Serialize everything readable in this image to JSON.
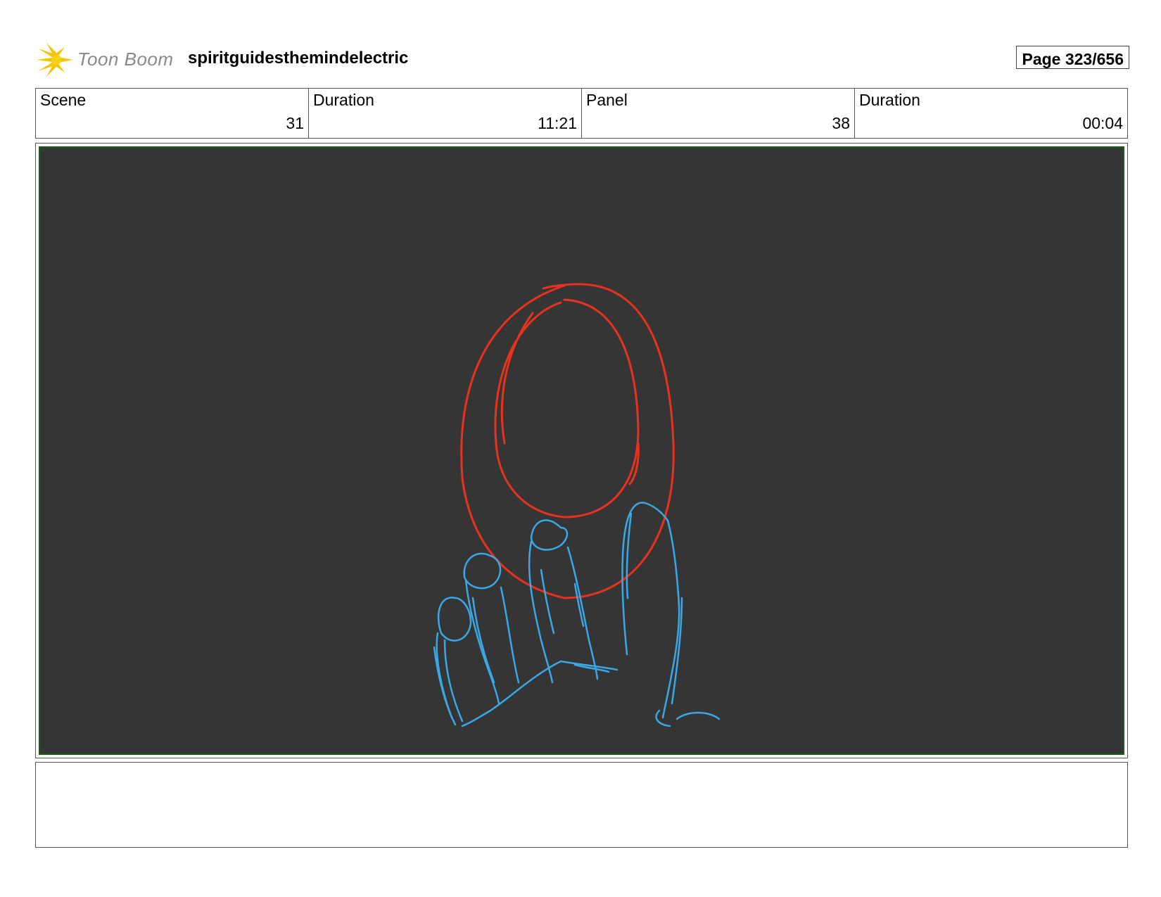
{
  "header": {
    "logo_text": "Toon Boom",
    "project_title": "spiritguidesthemindelectric",
    "page_label": "Page 323/656"
  },
  "info": {
    "scene": {
      "label": "Scene",
      "value": "31"
    },
    "scene_duration": {
      "label": "Duration",
      "value": "11:21"
    },
    "panel": {
      "label": "Panel",
      "value": "38"
    },
    "panel_duration": {
      "label": "Duration",
      "value": "00:04"
    }
  },
  "drawing": {
    "background_color": "#353535",
    "frame_color": "#1b5e1b",
    "ring_color": "#e8321e",
    "hand_color": "#3aa8e6"
  },
  "notes": {
    "text": ""
  }
}
